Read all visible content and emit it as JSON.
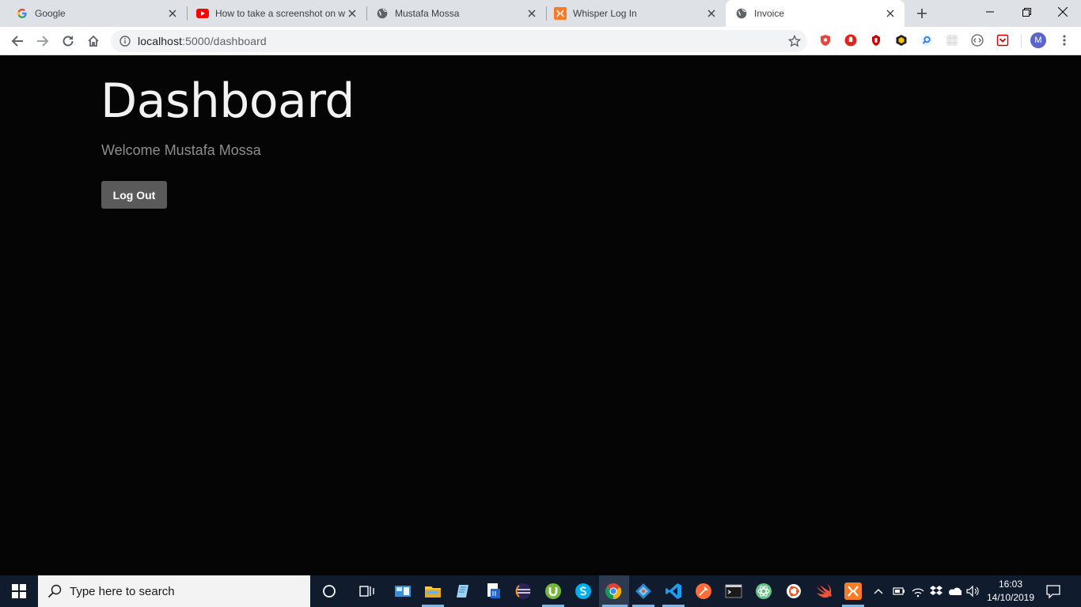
{
  "browser": {
    "tabs": [
      {
        "title": "Google",
        "icon": "google-icon",
        "active": false
      },
      {
        "title": "How to take a screenshot on w",
        "icon": "youtube-icon",
        "active": false
      },
      {
        "title": "Mustafa Mossa",
        "icon": "globe-icon",
        "active": false
      },
      {
        "title": "Whisper Log In",
        "icon": "xampp-icon",
        "active": false
      },
      {
        "title": "Invoice",
        "icon": "globe-icon",
        "active": true
      }
    ],
    "address": {
      "host": "localhost",
      "port_path": ":5000/dashboard"
    },
    "profile_initial": "M"
  },
  "page": {
    "heading": "Dashboard",
    "welcome": "Welcome Mustafa Mossa",
    "logout_label": "Log Out"
  },
  "taskbar": {
    "search_placeholder": "Type here to search",
    "time": "16:03",
    "date": "14/10/2019"
  },
  "colors": {
    "page_bg": "#050505",
    "button_bg": "#5a5a5a",
    "taskbar_bg": "#101b2e",
    "tabstrip_bg": "#dee1e6"
  }
}
